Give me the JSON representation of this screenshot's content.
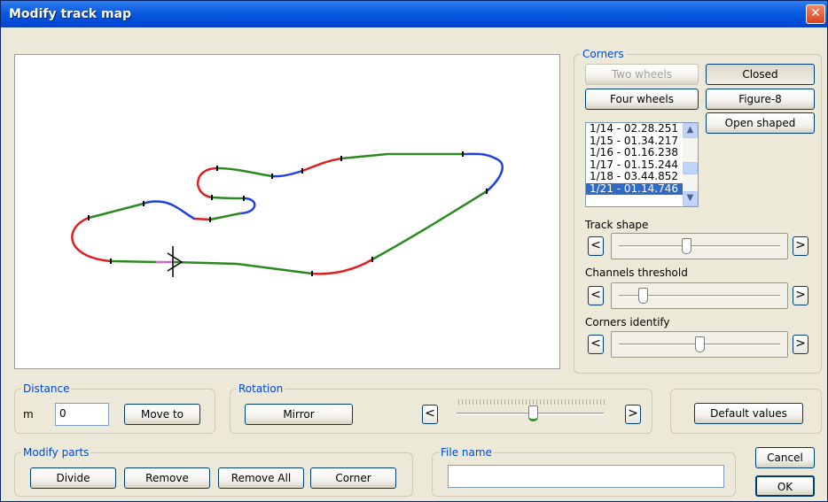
{
  "window": {
    "title": "Modify track map",
    "close_label": "✕"
  },
  "corners": {
    "legend": "Corners",
    "two_wheels": "Two wheels",
    "four_wheels": "Four wheels",
    "closed": "Closed",
    "figure8": "Figure-8",
    "open_shaped": "Open shaped",
    "laps": [
      "1/14 - 02.28.251",
      "1/15 - 01.34.217",
      "1/16 - 01.16.238",
      "1/17 - 01.15.244",
      "1/18 - 03.44.852",
      "1/21 - 01.14.746"
    ],
    "selected_lap": "1/21 - 01.14.746",
    "scroll_up": "▲",
    "scroll_down": "▼",
    "track_shape_label": "Track shape",
    "track_shape_value": 0.41,
    "channels_threshold_label": "Channels threshold",
    "channels_threshold_value": 0.12,
    "corners_identify_label": "Corners identify",
    "corners_identify_value": 0.5,
    "left_arrow": "<",
    "right_arrow": ">"
  },
  "distance": {
    "legend": "Distance",
    "unit": "m",
    "value": "0",
    "move_to": "Move to"
  },
  "rotation": {
    "legend": "Rotation",
    "mirror": "Mirror",
    "slider_value": 0.52,
    "left_arrow": "<",
    "right_arrow": ">"
  },
  "default_values": "Default values",
  "modify_parts": {
    "legend": "Modify parts",
    "divide": "Divide",
    "remove": "Remove",
    "remove_all": "Remove All",
    "corner": "Corner"
  },
  "file_name": {
    "legend": "File name",
    "value": ""
  },
  "cancel": "Cancel",
  "ok": "OK",
  "colors": {
    "straight": "#2a8a1f",
    "left_corner": "#e02020",
    "right_corner": "#2040e0",
    "start": "#cc66cc"
  }
}
